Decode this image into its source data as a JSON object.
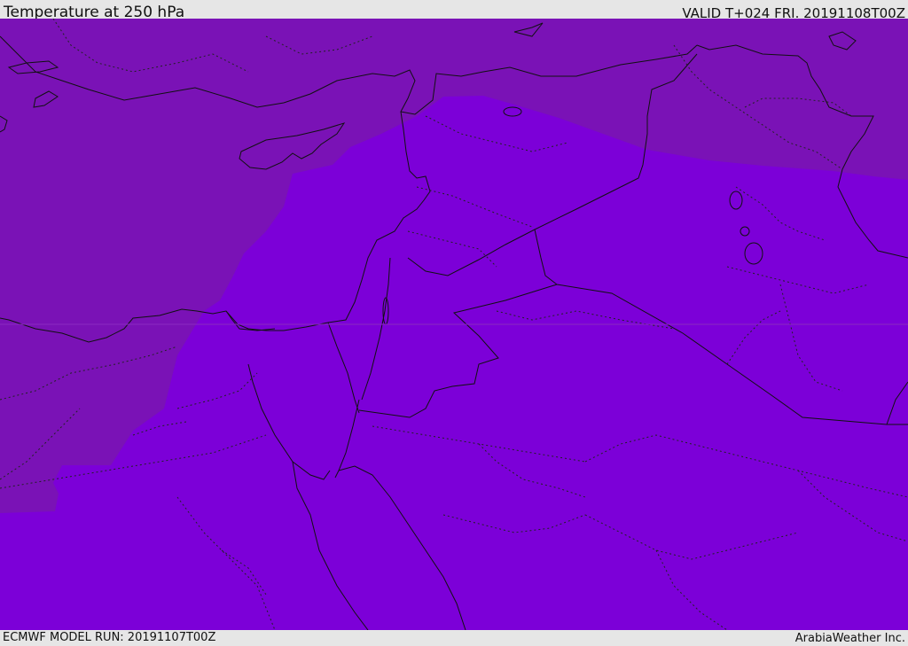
{
  "header": {
    "title": "Temperature at 250 hPa",
    "valid": "VALID T+024 FRI. 20191108T00Z"
  },
  "footer": {
    "model_run": "ECMWF MODEL RUN: 20191107T00Z",
    "brand": "ArabiaWeather Inc."
  },
  "colors": {
    "cold_zone": "#7a12b6",
    "warm_zone": "#7c00d8",
    "border_line": "#111111",
    "background": "#e6e6e6"
  }
}
